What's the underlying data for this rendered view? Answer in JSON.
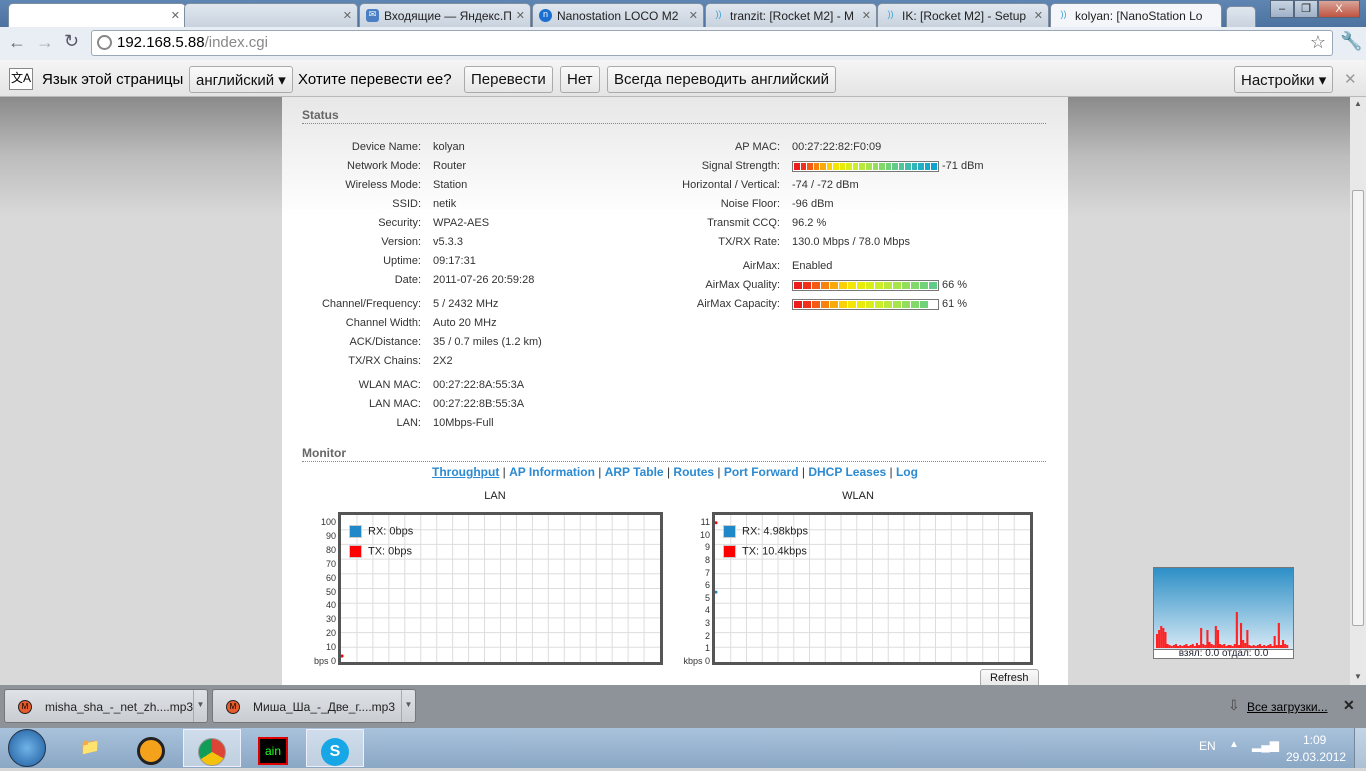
{
  "browser": {
    "tabs": [
      {
        "label": "",
        "icon": "blank-icon"
      },
      {
        "label": "",
        "icon": "blank-icon"
      },
      {
        "label": "Входящие — Яндекс.П",
        "icon": "mail-icon"
      },
      {
        "label": "Nanostation LOCO M2",
        "icon": "nag-icon"
      },
      {
        "label": "tranzit: [Rocket M2] - M",
        "icon": "wifi-icon"
      },
      {
        "label": "IK: [Rocket M2] - Setup",
        "icon": "wifi-icon"
      },
      {
        "label": "kolyan: [NanoStation Lo",
        "icon": "wifi-icon"
      }
    ],
    "url_host": "192.168.5.88",
    "url_path": "/index.cgi"
  },
  "translate_bar": {
    "page_lang_label": "Язык этой страницы",
    "lang": "английский",
    "question": "Хотите перевести ее?",
    "translate": "Перевести",
    "no": "Нет",
    "always": "Всегда переводить английский",
    "settings": "Настройки"
  },
  "status": {
    "title": "Status",
    "left": [
      {
        "label": "Device Name:",
        "value": "kolyan"
      },
      {
        "label": "Network Mode:",
        "value": "Router"
      },
      {
        "label": "Wireless Mode:",
        "value": "Station"
      },
      {
        "label": "SSID:",
        "value": "netik"
      },
      {
        "label": "Security:",
        "value": "WPA2-AES"
      },
      {
        "label": "Version:",
        "value": "v5.3.3"
      },
      {
        "label": "Uptime:",
        "value": "09:17:31"
      },
      {
        "label": "Date:",
        "value": "2011-07-26 20:59:28"
      },
      {
        "label": "Channel/Frequency:",
        "value": "5 / 2432 MHz"
      },
      {
        "label": "Channel Width:",
        "value": "Auto 20 MHz"
      },
      {
        "label": "ACK/Distance:",
        "value": "35 / 0.7 miles (1.2 km)"
      },
      {
        "label": "TX/RX Chains:",
        "value": "2X2"
      },
      {
        "label": "WLAN MAC:",
        "value": "00:27:22:8A:55:3A"
      },
      {
        "label": "LAN MAC:",
        "value": "00:27:22:8B:55:3A"
      },
      {
        "label": "LAN:",
        "value": "10Mbps-Full"
      }
    ],
    "right": [
      {
        "label": "AP MAC:",
        "value": "00:27:22:82:F0:09"
      },
      {
        "label": "Signal Strength:",
        "value": "-71 dBm",
        "bar_segments": 22
      },
      {
        "label": "Horizontal / Vertical:",
        "value": "-74 / -72 dBm"
      },
      {
        "label": "Noise Floor:",
        "value": "-96 dBm"
      },
      {
        "label": "Transmit CCQ:",
        "value": "96.2 %"
      },
      {
        "label": "TX/RX Rate:",
        "value": "130.0 Mbps / 78.0 Mbps"
      },
      {
        "label": "AirMax:",
        "value": "Enabled"
      },
      {
        "label": "AirMax Quality:",
        "value": "66 %",
        "bar_segments": 16
      },
      {
        "label": "AirMax Capacity:",
        "value": "61 %",
        "bar_segments": 15
      }
    ]
  },
  "monitor": {
    "title": "Monitor",
    "links": [
      "Throughput",
      "AP Information",
      "ARP Table",
      "Routes",
      "Port Forward",
      "DHCP Leases",
      "Log"
    ],
    "refresh": "Refresh"
  },
  "chart_data": [
    {
      "type": "line",
      "title": "LAN",
      "ylabel": "bps",
      "yticks": [
        "bps 0",
        "10",
        "20",
        "30",
        "40",
        "50",
        "60",
        "70",
        "80",
        "90",
        "100"
      ],
      "ylim": [
        0,
        100
      ],
      "legend": [
        "RX: 0bps",
        "TX: 0bps"
      ],
      "series": [
        {
          "name": "RX",
          "values": [
            0
          ]
        },
        {
          "name": "TX",
          "values": [
            0
          ]
        }
      ]
    },
    {
      "type": "line",
      "title": "WLAN",
      "ylabel": "kbps",
      "yticks": [
        "kbps 0",
        "1",
        "2",
        "3",
        "4",
        "5",
        "6",
        "7",
        "8",
        "9",
        "10",
        "11"
      ],
      "ylim": [
        0,
        11
      ],
      "legend": [
        "RX: 4.98kbps",
        "TX: 10.4kbps"
      ],
      "series": [
        {
          "name": "RX",
          "values": [
            4.98
          ]
        },
        {
          "name": "TX",
          "values": [
            10.4
          ]
        }
      ]
    }
  ],
  "colors": {
    "rx": "#1f88c9",
    "tx": "#ff0000",
    "link": "#2b8ad1"
  },
  "net_widget": {
    "text": "взял: 0.0 отдал: 0.0"
  },
  "downloads": {
    "items": [
      "misha_sha_-_net_zh....mp3",
      "Миша_Ша_-_Две_г....mp3"
    ],
    "all": "Все загрузки..."
  },
  "taskbar": {
    "lang": "EN",
    "time": "1:09",
    "date": "29.03.2012"
  }
}
